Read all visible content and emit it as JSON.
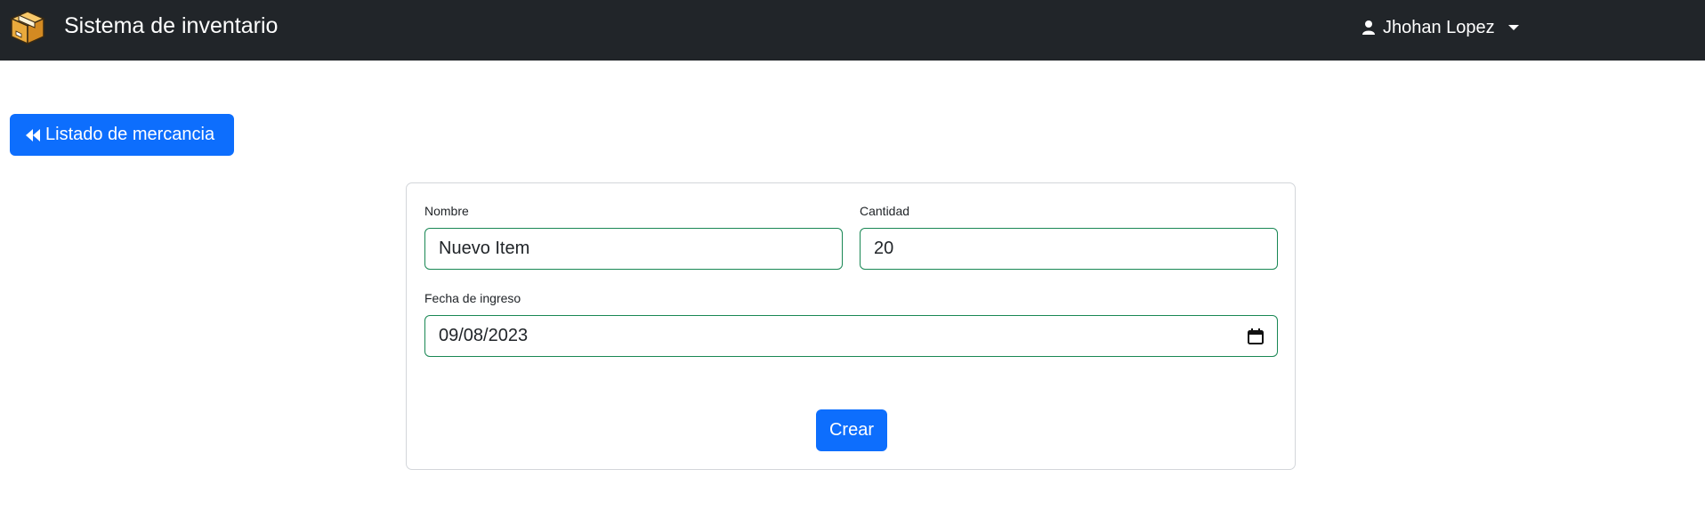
{
  "navbar": {
    "logo_icon": "package-box-icon",
    "title": "Sistema de inventario",
    "user_icon": "user-icon",
    "user_name": "Jhohan Lopez",
    "dropdown_icon": "caret-down-icon",
    "background": "#212529"
  },
  "back_button": {
    "icon": "double-chevron-left-icon",
    "label": "Listado de mercancia",
    "color": "#0d6efd"
  },
  "form": {
    "nombre": {
      "label": "Nombre",
      "value": "Nuevo Item"
    },
    "cantidad": {
      "label": "Cantidad",
      "value": "20"
    },
    "fecha": {
      "label": "Fecha de ingreso",
      "value": "09/08/2023",
      "icon": "calendar-icon"
    },
    "submit_label": "Crear",
    "valid_border_color": "#198754"
  }
}
